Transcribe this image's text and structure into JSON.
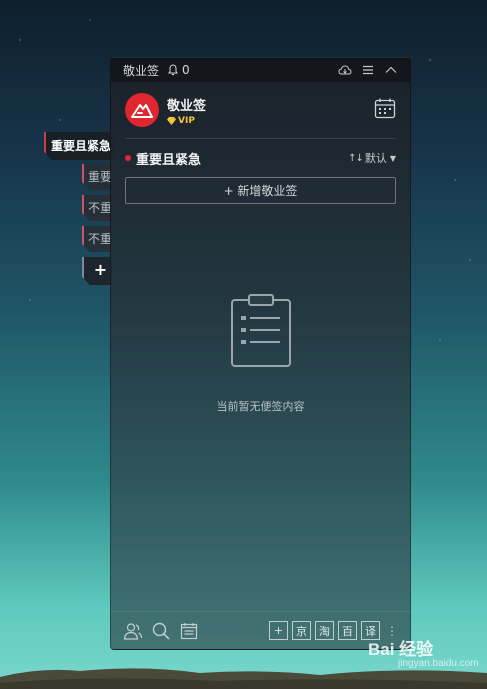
{
  "window": {
    "app_title": "敬业签",
    "notification_count": "0"
  },
  "header": {
    "brand_name": "敬业签",
    "vip_label": "VIP"
  },
  "side_tabs": {
    "active_label": "重要且紧急",
    "items": [
      "重要",
      "不重",
      "不重"
    ],
    "add_label": "+"
  },
  "list": {
    "title": "重要且紧急",
    "sort_label": "默认",
    "add_button_label": "+ 新增敬业签",
    "empty_message": "当前暂无便签内容"
  },
  "bottom": {
    "quick_buttons": [
      "+",
      "京",
      "淘",
      "百",
      "译"
    ]
  },
  "watermark": {
    "text": "Bai 经验",
    "sub": "jingyan.baidu.com"
  },
  "colors": {
    "brand_red": "#e0262e",
    "priority_dot": "#e0263a",
    "vip_gold": "#f3c63b"
  }
}
